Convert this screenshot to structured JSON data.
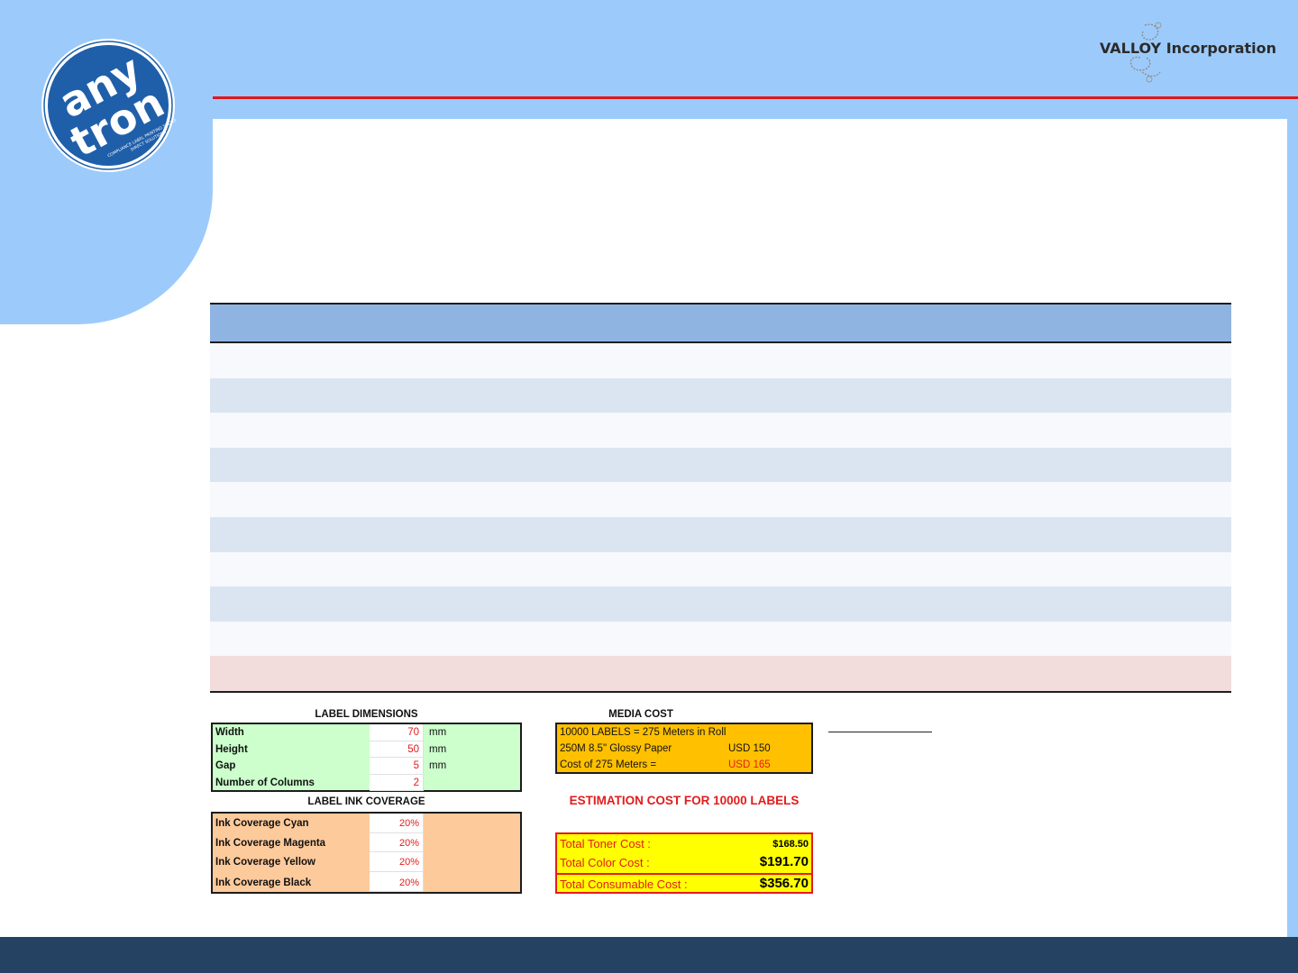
{
  "brand": {
    "left_logo_text": "any tron",
    "left_logo_tagline": "COMPLIANCE LABEL PRINTING SYSTEM DIRECT SOLUTIONS",
    "right_logo_text": "VALLOY Incorporation",
    "colors": {
      "sky": "#9ccbfb",
      "navy": "#264263",
      "accent_red": "#e4141a",
      "logo_blue": "#1f5faa"
    }
  },
  "main_table": {
    "header_color": "#90b4e1",
    "rows": [
      "light",
      "blue",
      "light",
      "blue",
      "light",
      "blue",
      "light",
      "blue",
      "light",
      "pink"
    ]
  },
  "label_dimensions": {
    "caption": "LABEL DIMENSIONS",
    "rows": [
      {
        "label": "Width",
        "value": "70",
        "unit": "mm"
      },
      {
        "label": "Height",
        "value": "50",
        "unit": "mm"
      },
      {
        "label": "Gap",
        "value": "5",
        "unit": "mm"
      },
      {
        "label": "Number of Columns",
        "value": "2",
        "unit": ""
      }
    ]
  },
  "ink_coverage": {
    "caption": "LABEL INK COVERAGE",
    "rows": [
      {
        "label": "Ink Coverage Cyan",
        "value": "20%"
      },
      {
        "label": "Ink Coverage Magenta",
        "value": "20%"
      },
      {
        "label": "Ink Coverage Yellow",
        "value": "20%"
      },
      {
        "label": "Ink Coverage Black",
        "value": "20%"
      }
    ]
  },
  "media_cost": {
    "caption": "MEDIA COST",
    "rows": [
      {
        "a": "10000 LABELS = 275 Meters in Roll",
        "b": ""
      },
      {
        "a": "250M 8.5\" Glossy Paper",
        "b": "USD 150"
      },
      {
        "a": "Cost of 275 Meters =",
        "b": "USD 165"
      }
    ]
  },
  "estimate": {
    "title": "ESTIMATION COST FOR 10000 LABELS",
    "toner_label": "Total Toner Cost :",
    "toner_value": "$168.50",
    "color_label": "Total Color Cost :",
    "color_value": "$191.70",
    "consumable_label": "Total Consumable Cost :",
    "consumable_value": "$356.70"
  }
}
